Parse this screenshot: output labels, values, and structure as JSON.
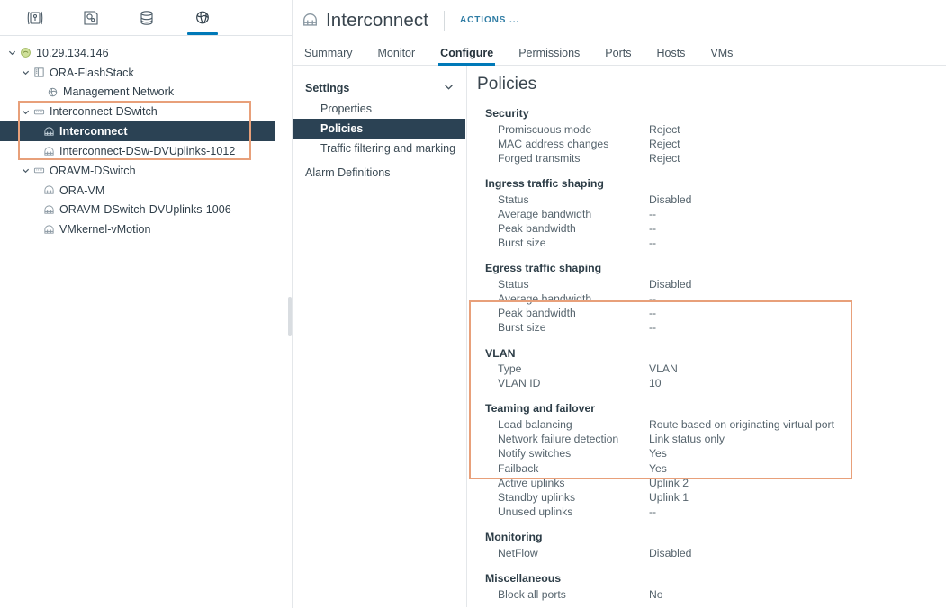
{
  "icon_bar": {
    "tabs": [
      {
        "name": "hosts-and-clusters-icon",
        "label": "Hosts and Clusters",
        "active": false
      },
      {
        "name": "vms-and-templates-icon",
        "label": "VMs and Templates",
        "active": false
      },
      {
        "name": "storage-icon",
        "label": "Storage",
        "active": false
      },
      {
        "name": "networking-icon",
        "label": "Networking",
        "active": true
      }
    ]
  },
  "tree": {
    "nodes": [
      {
        "label": "10.29.134.146",
        "depth": 0,
        "twisty": "down",
        "icon": "vcenter-icon",
        "selected": false
      },
      {
        "label": "ORA-FlashStack",
        "depth": 1,
        "twisty": "down",
        "icon": "datacenter-icon",
        "selected": false
      },
      {
        "label": "Management Network",
        "depth": 2,
        "twisty": "none",
        "icon": "network-icon",
        "selected": false
      },
      {
        "label": "Interconnect-DSwitch",
        "depth": 1,
        "twisty": "down",
        "icon": "dswitch-icon",
        "selected": false
      },
      {
        "label": "Interconnect",
        "depth": 2,
        "twisty": "none",
        "icon": "portgroup-icon",
        "selected": true
      },
      {
        "label": "Interconnect-DSw-DVUplinks-1012",
        "depth": 2,
        "twisty": "none",
        "icon": "portgroup-icon",
        "selected": false
      },
      {
        "label": "ORAVM-DSwitch",
        "depth": 1,
        "twisty": "down",
        "icon": "dswitch-icon",
        "selected": false
      },
      {
        "label": "ORA-VM",
        "depth": 2,
        "twisty": "none",
        "icon": "portgroup-icon",
        "selected": false
      },
      {
        "label": "ORAVM-DSwitch-DVUplinks-1006",
        "depth": 2,
        "twisty": "none",
        "icon": "portgroup-icon",
        "selected": false
      },
      {
        "label": "VMkernel-vMotion",
        "depth": 2,
        "twisty": "none",
        "icon": "portgroup-icon",
        "selected": false
      }
    ]
  },
  "header": {
    "title": "Interconnect",
    "actions_label": "ACTIONS ..."
  },
  "tabs": [
    {
      "label": "Summary",
      "active": false
    },
    {
      "label": "Monitor",
      "active": false
    },
    {
      "label": "Configure",
      "active": true
    },
    {
      "label": "Permissions",
      "active": false
    },
    {
      "label": "Ports",
      "active": false
    },
    {
      "label": "Hosts",
      "active": false
    },
    {
      "label": "VMs",
      "active": false
    }
  ],
  "settings_nav": {
    "group_label": "Settings",
    "items": [
      {
        "label": "Properties",
        "selected": false
      },
      {
        "label": "Policies",
        "selected": true
      },
      {
        "label": "Traffic filtering and marking",
        "selected": false
      }
    ],
    "root_item": "Alarm Definitions"
  },
  "policies": {
    "title": "Policies",
    "sections": [
      {
        "heading": "Security",
        "rows": [
          {
            "key": "Promiscuous mode",
            "value": "Reject"
          },
          {
            "key": "MAC address changes",
            "value": "Reject"
          },
          {
            "key": "Forged transmits",
            "value": "Reject"
          }
        ]
      },
      {
        "heading": "Ingress traffic shaping",
        "rows": [
          {
            "key": "Status",
            "value": "Disabled"
          },
          {
            "key": "Average bandwidth",
            "value": "--"
          },
          {
            "key": "Peak bandwidth",
            "value": "--"
          },
          {
            "key": "Burst size",
            "value": "--"
          }
        ]
      },
      {
        "heading": "Egress traffic shaping",
        "rows": [
          {
            "key": "Status",
            "value": "Disabled"
          },
          {
            "key": "Average bandwidth",
            "value": "--"
          },
          {
            "key": "Peak bandwidth",
            "value": "--"
          },
          {
            "key": "Burst size",
            "value": "--"
          }
        ]
      },
      {
        "heading": "VLAN",
        "rows": [
          {
            "key": "Type",
            "value": "VLAN"
          },
          {
            "key": "VLAN ID",
            "value": "10"
          }
        ]
      },
      {
        "heading": "Teaming and failover",
        "rows": [
          {
            "key": "Load balancing",
            "value": "Route based on originating virtual port"
          },
          {
            "key": "Network failure detection",
            "value": "Link status only"
          },
          {
            "key": "Notify switches",
            "value": "Yes"
          },
          {
            "key": "Failback",
            "value": "Yes"
          },
          {
            "key": "Active uplinks",
            "value": "Uplink 2"
          },
          {
            "key": "Standby uplinks",
            "value": "Uplink 1"
          },
          {
            "key": "Unused uplinks",
            "value": "--"
          }
        ]
      },
      {
        "heading": "Monitoring",
        "rows": [
          {
            "key": "NetFlow",
            "value": "Disabled"
          }
        ]
      },
      {
        "heading": "Miscellaneous",
        "rows": [
          {
            "key": "Block all ports",
            "value": "No"
          }
        ]
      }
    ]
  },
  "colors": {
    "accent_blue": "#0079b8",
    "selection_navy": "#2b4254",
    "highlight_orange": "#e8a07a",
    "link_blue": "#2f7ca4"
  }
}
